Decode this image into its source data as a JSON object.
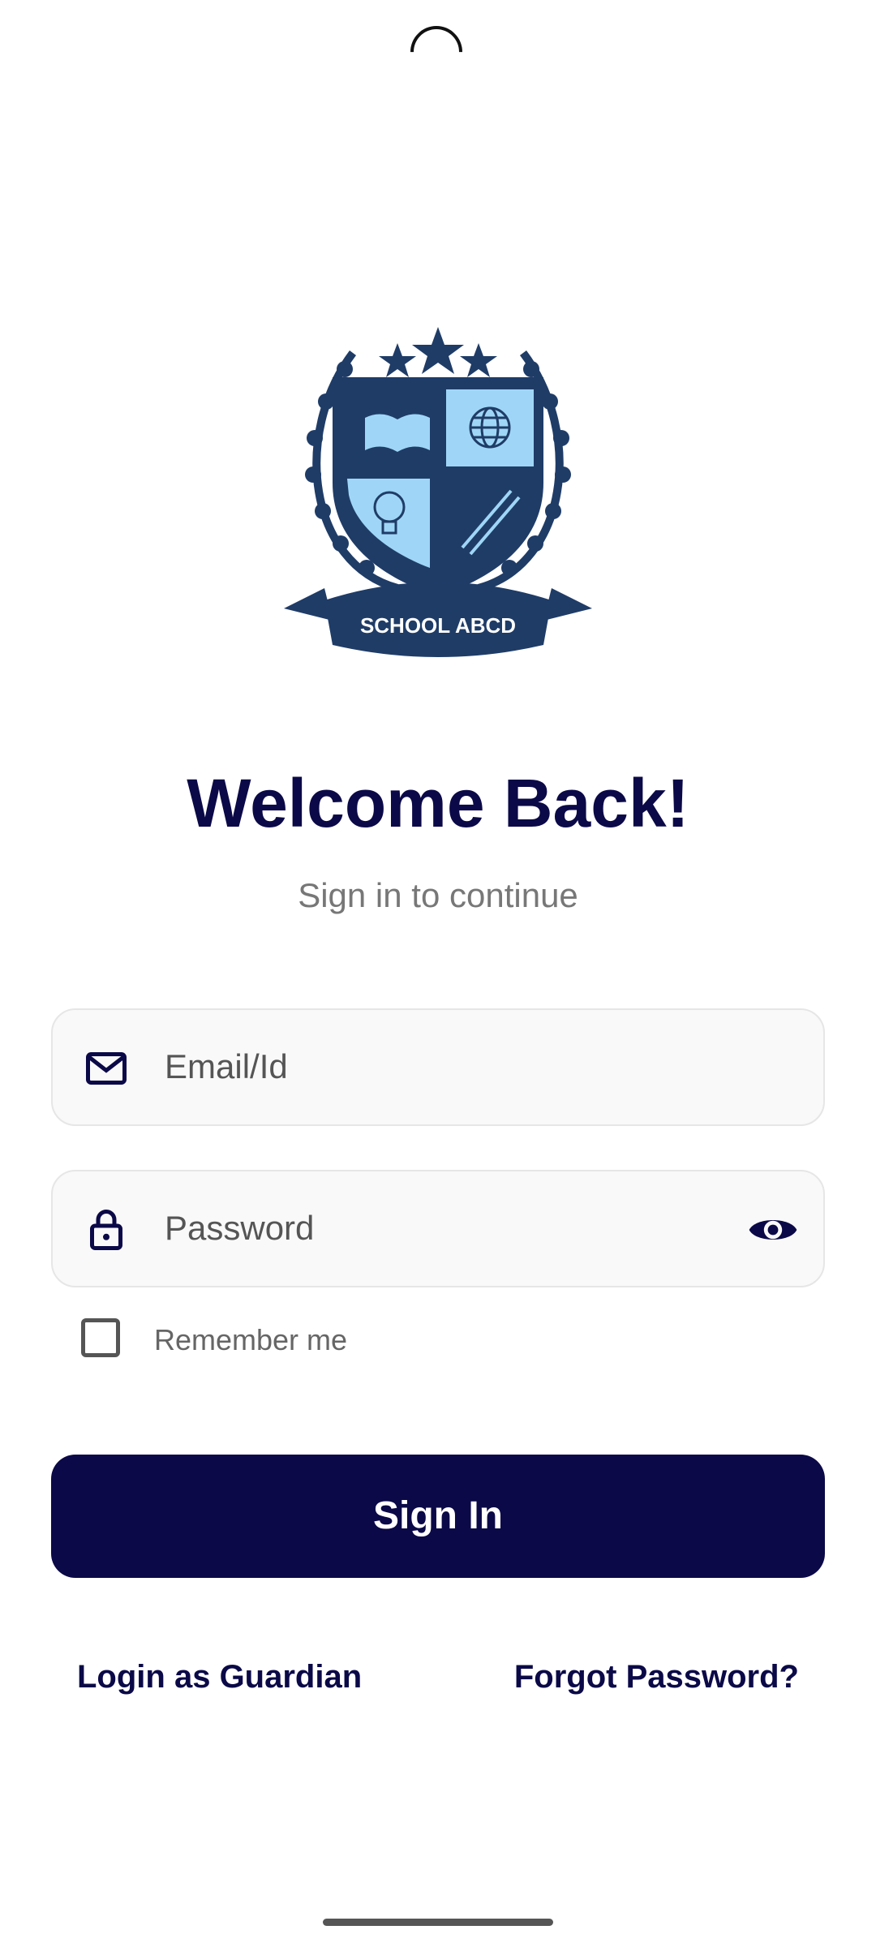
{
  "logo": {
    "text": "SCHOOL ABCD"
  },
  "header": {
    "title": "Welcome Back!",
    "subtitle": "Sign in to continue"
  },
  "form": {
    "email_placeholder": "Email/Id",
    "password_placeholder": "Password",
    "remember_label": "Remember me",
    "remember_checked": false,
    "signin_label": "Sign In"
  },
  "links": {
    "guardian": "Login as Guardian",
    "forgot": "Forgot Password?"
  },
  "colors": {
    "primary": "#0b0947",
    "logo_navy": "#1f3c67",
    "logo_light_blue": "#9fd6f7"
  },
  "icons": {
    "email": "mail-icon",
    "password": "lock-icon",
    "toggle": "eye-icon"
  }
}
